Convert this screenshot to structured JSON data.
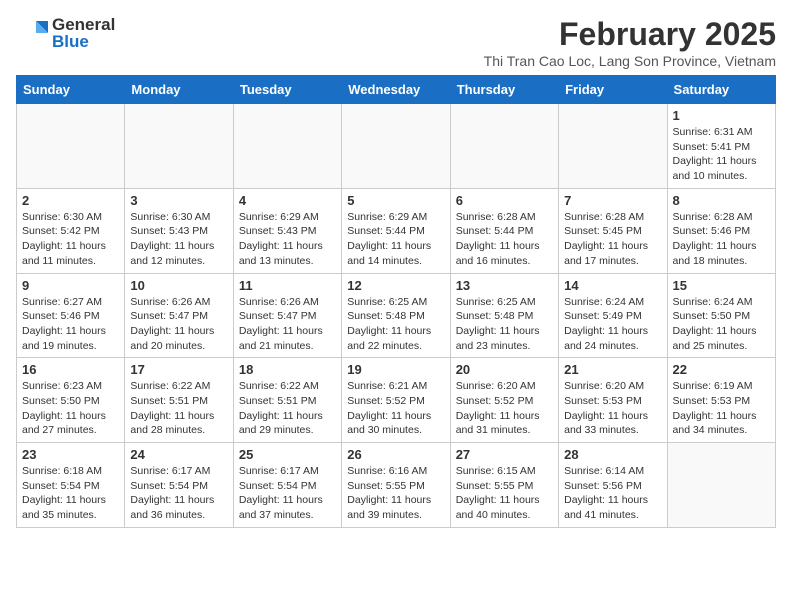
{
  "header": {
    "logo_general": "General",
    "logo_blue": "Blue",
    "month_title": "February 2025",
    "location": "Thi Tran Cao Loc, Lang Son Province, Vietnam"
  },
  "weekdays": [
    "Sunday",
    "Monday",
    "Tuesday",
    "Wednesday",
    "Thursday",
    "Friday",
    "Saturday"
  ],
  "weeks": [
    [
      {
        "day": "",
        "info": ""
      },
      {
        "day": "",
        "info": ""
      },
      {
        "day": "",
        "info": ""
      },
      {
        "day": "",
        "info": ""
      },
      {
        "day": "",
        "info": ""
      },
      {
        "day": "",
        "info": ""
      },
      {
        "day": "1",
        "info": "Sunrise: 6:31 AM\nSunset: 5:41 PM\nDaylight: 11 hours and 10 minutes."
      }
    ],
    [
      {
        "day": "2",
        "info": "Sunrise: 6:30 AM\nSunset: 5:42 PM\nDaylight: 11 hours and 11 minutes."
      },
      {
        "day": "3",
        "info": "Sunrise: 6:30 AM\nSunset: 5:43 PM\nDaylight: 11 hours and 12 minutes."
      },
      {
        "day": "4",
        "info": "Sunrise: 6:29 AM\nSunset: 5:43 PM\nDaylight: 11 hours and 13 minutes."
      },
      {
        "day": "5",
        "info": "Sunrise: 6:29 AM\nSunset: 5:44 PM\nDaylight: 11 hours and 14 minutes."
      },
      {
        "day": "6",
        "info": "Sunrise: 6:28 AM\nSunset: 5:44 PM\nDaylight: 11 hours and 16 minutes."
      },
      {
        "day": "7",
        "info": "Sunrise: 6:28 AM\nSunset: 5:45 PM\nDaylight: 11 hours and 17 minutes."
      },
      {
        "day": "8",
        "info": "Sunrise: 6:28 AM\nSunset: 5:46 PM\nDaylight: 11 hours and 18 minutes."
      }
    ],
    [
      {
        "day": "9",
        "info": "Sunrise: 6:27 AM\nSunset: 5:46 PM\nDaylight: 11 hours and 19 minutes."
      },
      {
        "day": "10",
        "info": "Sunrise: 6:26 AM\nSunset: 5:47 PM\nDaylight: 11 hours and 20 minutes."
      },
      {
        "day": "11",
        "info": "Sunrise: 6:26 AM\nSunset: 5:47 PM\nDaylight: 11 hours and 21 minutes."
      },
      {
        "day": "12",
        "info": "Sunrise: 6:25 AM\nSunset: 5:48 PM\nDaylight: 11 hours and 22 minutes."
      },
      {
        "day": "13",
        "info": "Sunrise: 6:25 AM\nSunset: 5:48 PM\nDaylight: 11 hours and 23 minutes."
      },
      {
        "day": "14",
        "info": "Sunrise: 6:24 AM\nSunset: 5:49 PM\nDaylight: 11 hours and 24 minutes."
      },
      {
        "day": "15",
        "info": "Sunrise: 6:24 AM\nSunset: 5:50 PM\nDaylight: 11 hours and 25 minutes."
      }
    ],
    [
      {
        "day": "16",
        "info": "Sunrise: 6:23 AM\nSunset: 5:50 PM\nDaylight: 11 hours and 27 minutes."
      },
      {
        "day": "17",
        "info": "Sunrise: 6:22 AM\nSunset: 5:51 PM\nDaylight: 11 hours and 28 minutes."
      },
      {
        "day": "18",
        "info": "Sunrise: 6:22 AM\nSunset: 5:51 PM\nDaylight: 11 hours and 29 minutes."
      },
      {
        "day": "19",
        "info": "Sunrise: 6:21 AM\nSunset: 5:52 PM\nDaylight: 11 hours and 30 minutes."
      },
      {
        "day": "20",
        "info": "Sunrise: 6:20 AM\nSunset: 5:52 PM\nDaylight: 11 hours and 31 minutes."
      },
      {
        "day": "21",
        "info": "Sunrise: 6:20 AM\nSunset: 5:53 PM\nDaylight: 11 hours and 33 minutes."
      },
      {
        "day": "22",
        "info": "Sunrise: 6:19 AM\nSunset: 5:53 PM\nDaylight: 11 hours and 34 minutes."
      }
    ],
    [
      {
        "day": "23",
        "info": "Sunrise: 6:18 AM\nSunset: 5:54 PM\nDaylight: 11 hours and 35 minutes."
      },
      {
        "day": "24",
        "info": "Sunrise: 6:17 AM\nSunset: 5:54 PM\nDaylight: 11 hours and 36 minutes."
      },
      {
        "day": "25",
        "info": "Sunrise: 6:17 AM\nSunset: 5:54 PM\nDaylight: 11 hours and 37 minutes."
      },
      {
        "day": "26",
        "info": "Sunrise: 6:16 AM\nSunset: 5:55 PM\nDaylight: 11 hours and 39 minutes."
      },
      {
        "day": "27",
        "info": "Sunrise: 6:15 AM\nSunset: 5:55 PM\nDaylight: 11 hours and 40 minutes."
      },
      {
        "day": "28",
        "info": "Sunrise: 6:14 AM\nSunset: 5:56 PM\nDaylight: 11 hours and 41 minutes."
      },
      {
        "day": "",
        "info": ""
      }
    ]
  ]
}
